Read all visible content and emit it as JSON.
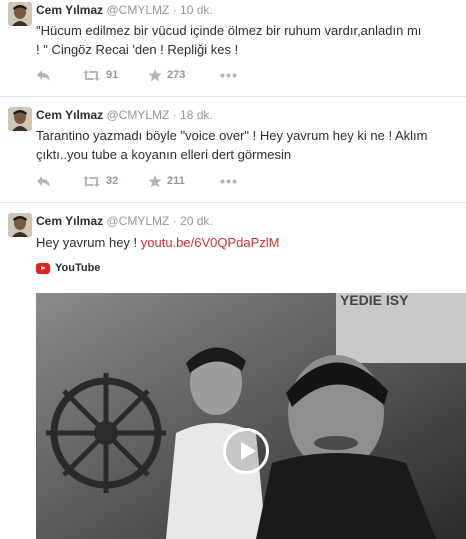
{
  "tweets": [
    {
      "name": "Cem Yılmaz",
      "handle": "@CMYLMZ",
      "separator": "·",
      "time": "10 dk.",
      "text_line1": "\"Hücum edilmez bir vücud içinde ölmez bir ruhum vardır,anladın mı",
      "text_line2": "! \" Cingöz Recai 'den ! Repliği kes !",
      "retweets": "91",
      "favorites": "273"
    },
    {
      "name": "Cem Yılmaz",
      "handle": "@CMYLMZ",
      "separator": "·",
      "time": "18 dk.",
      "text_line1": "Tarantino yazmadı böyle \"voice over\" ! Hey yavrum hey ki ne ! Aklım",
      "text_line2": "çıktı..you tube a koyanın elleri dert görmesin",
      "retweets": "32",
      "favorites": "211"
    },
    {
      "name": "Cem Yılmaz",
      "handle": "@CMYLMZ",
      "separator": "·",
      "time": "20 dk.",
      "text": "Hey yavrum hey ! ",
      "link": "youtu.be/6V0QPdaPzlM",
      "card_source": "YouTube",
      "video_sign_text": "YEDIE ISY"
    }
  ],
  "icons": {
    "reply": "reply-icon",
    "retweet": "retweet-icon",
    "favorite": "star-icon",
    "more": "more-icon",
    "play": "play-icon",
    "youtube": "youtube-logo-icon"
  },
  "colors": {
    "link": "#d32f2f",
    "muted": "#8899a6",
    "youtube_red": "#e62117"
  }
}
